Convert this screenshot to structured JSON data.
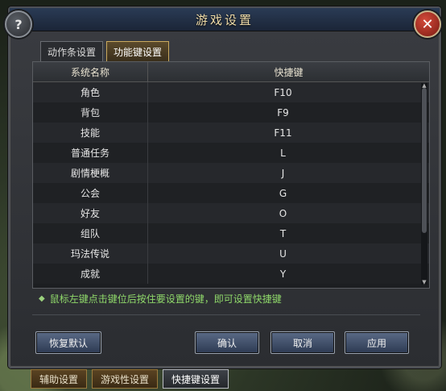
{
  "window": {
    "title": "游戏设置",
    "help_label": "?",
    "close_label": "✕"
  },
  "top_tabs": [
    {
      "label": "动作条设置",
      "active": false
    },
    {
      "label": "功能键设置",
      "active": true
    }
  ],
  "table": {
    "headers": [
      "系统名称",
      "快捷键"
    ],
    "rows": [
      {
        "name": "角色",
        "key": "F10"
      },
      {
        "name": "背包",
        "key": "F9"
      },
      {
        "name": "技能",
        "key": "F11"
      },
      {
        "name": "普通任务",
        "key": "L"
      },
      {
        "name": "剧情梗概",
        "key": "J"
      },
      {
        "name": "公会",
        "key": "G"
      },
      {
        "name": "好友",
        "key": "O"
      },
      {
        "name": "组队",
        "key": "T"
      },
      {
        "name": "玛法传说",
        "key": "U"
      },
      {
        "name": "成就",
        "key": "Y"
      }
    ]
  },
  "hint": "鼠标左键点击键位后按住要设置的键，即可设置快捷键",
  "buttons": {
    "restore": "恢复默认",
    "confirm": "确认",
    "cancel": "取消",
    "apply": "应用"
  },
  "bottom_tabs": [
    {
      "label": "辅助设置",
      "active": false
    },
    {
      "label": "游戏性设置",
      "active": false
    },
    {
      "label": "快捷键设置",
      "active": true
    }
  ],
  "colors": {
    "hint": "#8fd86a",
    "title": "#f0dca8"
  }
}
